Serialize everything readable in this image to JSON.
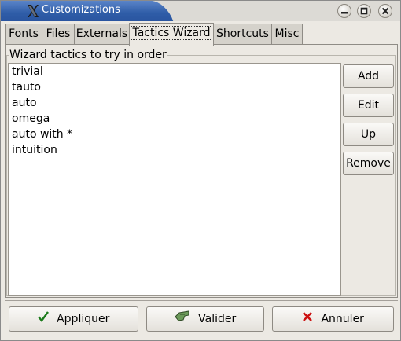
{
  "window": {
    "title": "Customizations",
    "app_icon": "x-logo-icon",
    "controls": [
      "minimize-icon",
      "maximize-icon",
      "close-icon"
    ]
  },
  "tabs": [
    {
      "label": "Fonts",
      "active": false
    },
    {
      "label": "Files",
      "active": false
    },
    {
      "label": "Externals",
      "active": false
    },
    {
      "label": "Tactics Wizard",
      "active": true
    },
    {
      "label": "Shortcuts",
      "active": false
    },
    {
      "label": "Misc",
      "active": false
    }
  ],
  "panel": {
    "group_label": "Wizard tactics to try in order",
    "items": [
      "trivial",
      "tauto",
      "auto",
      "omega",
      "auto with *",
      "intuition"
    ],
    "buttons": {
      "add": "Add",
      "edit": "Edit",
      "up": "Up",
      "remove": "Remove"
    }
  },
  "footer": {
    "apply": {
      "label": "Appliquer",
      "icon": "checkmark-icon"
    },
    "validate": {
      "label": "Valider",
      "icon": "ok-hand-icon"
    },
    "cancel": {
      "label": "Annuler",
      "icon": "red-x-icon"
    }
  },
  "colors": {
    "titlebar": "#2f5da8",
    "cancel_icon": "#cc1111",
    "apply_icon": "#1a7a1a"
  }
}
